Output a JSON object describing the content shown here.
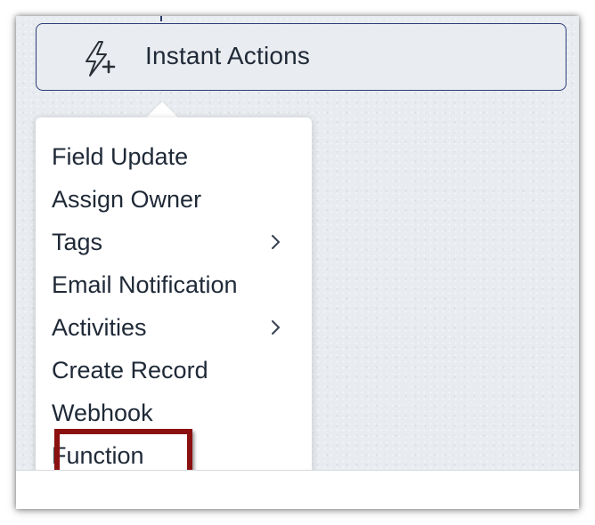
{
  "header": {
    "title": "Instant Actions",
    "icon": "lightning-plus-icon"
  },
  "menu": {
    "items": [
      {
        "label": "Field Update",
        "has_submenu": false
      },
      {
        "label": "Assign Owner",
        "has_submenu": false
      },
      {
        "label": "Tags",
        "has_submenu": true
      },
      {
        "label": "Email Notification",
        "has_submenu": false
      },
      {
        "label": "Activities",
        "has_submenu": true
      },
      {
        "label": "Create Record",
        "has_submenu": false
      },
      {
        "label": "Webhook",
        "has_submenu": false
      },
      {
        "label": "Function",
        "has_submenu": false,
        "highlighted": true
      }
    ]
  },
  "colors": {
    "accent_border": "#2c3e79",
    "highlight_box": "#8b1010",
    "text": "#1f2937",
    "canvas": "#e8ebef"
  }
}
